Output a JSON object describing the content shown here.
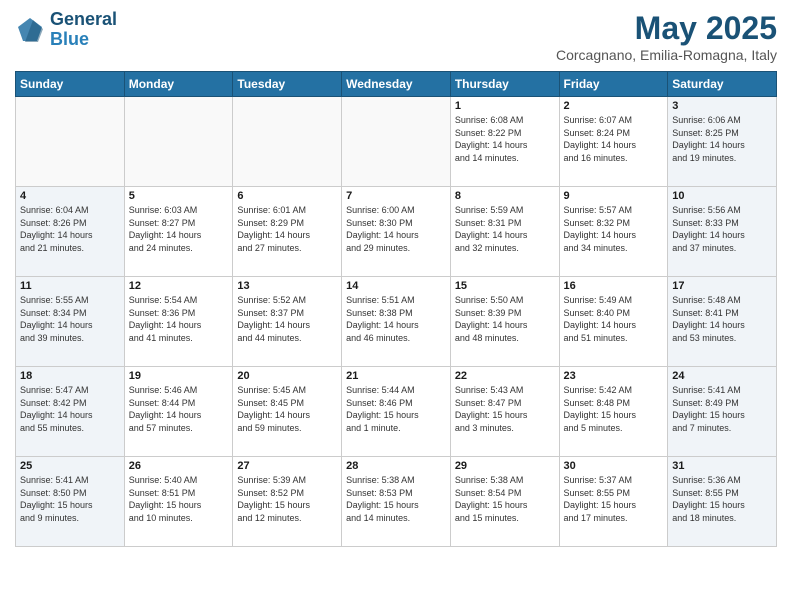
{
  "header": {
    "logo_line1": "General",
    "logo_line2": "Blue",
    "month_title": "May 2025",
    "location": "Corcagnano, Emilia-Romagna, Italy"
  },
  "weekdays": [
    "Sunday",
    "Monday",
    "Tuesday",
    "Wednesday",
    "Thursday",
    "Friday",
    "Saturday"
  ],
  "weeks": [
    [
      {
        "day": "",
        "info": "",
        "type": "empty"
      },
      {
        "day": "",
        "info": "",
        "type": "empty"
      },
      {
        "day": "",
        "info": "",
        "type": "empty"
      },
      {
        "day": "",
        "info": "",
        "type": "empty"
      },
      {
        "day": "1",
        "info": "Sunrise: 6:08 AM\nSunset: 8:22 PM\nDaylight: 14 hours\nand 14 minutes.",
        "type": "weekday"
      },
      {
        "day": "2",
        "info": "Sunrise: 6:07 AM\nSunset: 8:24 PM\nDaylight: 14 hours\nand 16 minutes.",
        "type": "weekday"
      },
      {
        "day": "3",
        "info": "Sunrise: 6:06 AM\nSunset: 8:25 PM\nDaylight: 14 hours\nand 19 minutes.",
        "type": "weekend"
      }
    ],
    [
      {
        "day": "4",
        "info": "Sunrise: 6:04 AM\nSunset: 8:26 PM\nDaylight: 14 hours\nand 21 minutes.",
        "type": "weekend"
      },
      {
        "day": "5",
        "info": "Sunrise: 6:03 AM\nSunset: 8:27 PM\nDaylight: 14 hours\nand 24 minutes.",
        "type": "weekday"
      },
      {
        "day": "6",
        "info": "Sunrise: 6:01 AM\nSunset: 8:29 PM\nDaylight: 14 hours\nand 27 minutes.",
        "type": "weekday"
      },
      {
        "day": "7",
        "info": "Sunrise: 6:00 AM\nSunset: 8:30 PM\nDaylight: 14 hours\nand 29 minutes.",
        "type": "weekday"
      },
      {
        "day": "8",
        "info": "Sunrise: 5:59 AM\nSunset: 8:31 PM\nDaylight: 14 hours\nand 32 minutes.",
        "type": "weekday"
      },
      {
        "day": "9",
        "info": "Sunrise: 5:57 AM\nSunset: 8:32 PM\nDaylight: 14 hours\nand 34 minutes.",
        "type": "weekday"
      },
      {
        "day": "10",
        "info": "Sunrise: 5:56 AM\nSunset: 8:33 PM\nDaylight: 14 hours\nand 37 minutes.",
        "type": "weekend"
      }
    ],
    [
      {
        "day": "11",
        "info": "Sunrise: 5:55 AM\nSunset: 8:34 PM\nDaylight: 14 hours\nand 39 minutes.",
        "type": "weekend"
      },
      {
        "day": "12",
        "info": "Sunrise: 5:54 AM\nSunset: 8:36 PM\nDaylight: 14 hours\nand 41 minutes.",
        "type": "weekday"
      },
      {
        "day": "13",
        "info": "Sunrise: 5:52 AM\nSunset: 8:37 PM\nDaylight: 14 hours\nand 44 minutes.",
        "type": "weekday"
      },
      {
        "day": "14",
        "info": "Sunrise: 5:51 AM\nSunset: 8:38 PM\nDaylight: 14 hours\nand 46 minutes.",
        "type": "weekday"
      },
      {
        "day": "15",
        "info": "Sunrise: 5:50 AM\nSunset: 8:39 PM\nDaylight: 14 hours\nand 48 minutes.",
        "type": "weekday"
      },
      {
        "day": "16",
        "info": "Sunrise: 5:49 AM\nSunset: 8:40 PM\nDaylight: 14 hours\nand 51 minutes.",
        "type": "weekday"
      },
      {
        "day": "17",
        "info": "Sunrise: 5:48 AM\nSunset: 8:41 PM\nDaylight: 14 hours\nand 53 minutes.",
        "type": "weekend"
      }
    ],
    [
      {
        "day": "18",
        "info": "Sunrise: 5:47 AM\nSunset: 8:42 PM\nDaylight: 14 hours\nand 55 minutes.",
        "type": "weekend"
      },
      {
        "day": "19",
        "info": "Sunrise: 5:46 AM\nSunset: 8:44 PM\nDaylight: 14 hours\nand 57 minutes.",
        "type": "weekday"
      },
      {
        "day": "20",
        "info": "Sunrise: 5:45 AM\nSunset: 8:45 PM\nDaylight: 14 hours\nand 59 minutes.",
        "type": "weekday"
      },
      {
        "day": "21",
        "info": "Sunrise: 5:44 AM\nSunset: 8:46 PM\nDaylight: 15 hours\nand 1 minute.",
        "type": "weekday"
      },
      {
        "day": "22",
        "info": "Sunrise: 5:43 AM\nSunset: 8:47 PM\nDaylight: 15 hours\nand 3 minutes.",
        "type": "weekday"
      },
      {
        "day": "23",
        "info": "Sunrise: 5:42 AM\nSunset: 8:48 PM\nDaylight: 15 hours\nand 5 minutes.",
        "type": "weekday"
      },
      {
        "day": "24",
        "info": "Sunrise: 5:41 AM\nSunset: 8:49 PM\nDaylight: 15 hours\nand 7 minutes.",
        "type": "weekend"
      }
    ],
    [
      {
        "day": "25",
        "info": "Sunrise: 5:41 AM\nSunset: 8:50 PM\nDaylight: 15 hours\nand 9 minutes.",
        "type": "weekend"
      },
      {
        "day": "26",
        "info": "Sunrise: 5:40 AM\nSunset: 8:51 PM\nDaylight: 15 hours\nand 10 minutes.",
        "type": "weekday"
      },
      {
        "day": "27",
        "info": "Sunrise: 5:39 AM\nSunset: 8:52 PM\nDaylight: 15 hours\nand 12 minutes.",
        "type": "weekday"
      },
      {
        "day": "28",
        "info": "Sunrise: 5:38 AM\nSunset: 8:53 PM\nDaylight: 15 hours\nand 14 minutes.",
        "type": "weekday"
      },
      {
        "day": "29",
        "info": "Sunrise: 5:38 AM\nSunset: 8:54 PM\nDaylight: 15 hours\nand 15 minutes.",
        "type": "weekday"
      },
      {
        "day": "30",
        "info": "Sunrise: 5:37 AM\nSunset: 8:55 PM\nDaylight: 15 hours\nand 17 minutes.",
        "type": "weekday"
      },
      {
        "day": "31",
        "info": "Sunrise: 5:36 AM\nSunset: 8:55 PM\nDaylight: 15 hours\nand 18 minutes.",
        "type": "weekend"
      }
    ]
  ]
}
